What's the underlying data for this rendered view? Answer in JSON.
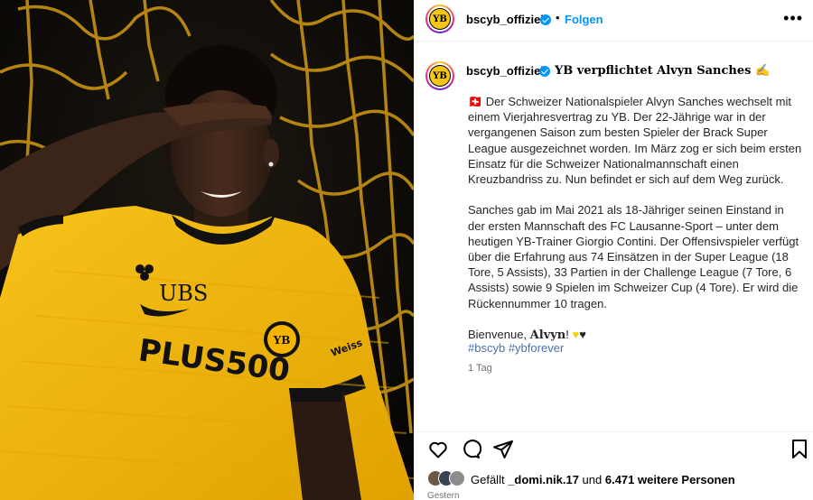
{
  "post": {
    "username": "bscyb_offiziell",
    "follow_label": "Folgen",
    "dot": "•",
    "more_label": "•••",
    "avatar_text": "YB"
  },
  "image": {
    "sponsor_top": "UBS",
    "sponsor_main": "PLUS500",
    "sleeve_text": "Weiss",
    "crest_text": "YB"
  },
  "caption": {
    "username": "bscyb_offiziell",
    "title": "YB verpflichtet Alvyn Sanches ✍️",
    "body_p1": "🇨🇭 Der Schweizer Nationalspieler Alvyn Sanches wechselt mit einem Vierjahresvertrag zu YB. Der 22-Jährige war in der vergangenen Saison zum besten Spieler der Brack Super League ausgezeichnet worden. Im März zog er sich beim ersten Einsatz für die Schweizer Nationalmannschaft einen Kreuzbandriss zu. Nun befindet er sich auf dem Weg zurück.",
    "body_p2": "Sanches gab im Mai 2021 als 18-Jähriger seinen Einstand in der ersten Mannschaft des FC Lausanne-Sport – unter dem heutigen YB-Trainer Giorgio Contini. Der Offensivspieler verfügt über die Erfahrung aus 74 Einsätzen in der Super League (18 Tore, 5 Assists), 33 Partien in der Challenge League (7 Tore, 6 Assists) sowie 9 Spielen im Schweizer Cup (4 Tore). Er wird die Rückennummer 10 tragen.",
    "body_p3_prefix": "Bienvenue, ",
    "body_p3_name": "Alvyn",
    "body_p3_suffix": "! ",
    "heart_yellow": "♥",
    "heart_black": "♥",
    "hashtag1": "#bscyb",
    "hashtag2": "#ybforever",
    "time": "1 Tag"
  },
  "footer": {
    "likes_prefix": "Gefällt ",
    "liker": "_domi.nik.17",
    "likes_mid": " und ",
    "likes_count": "6.471 weitere Personen",
    "time": "Gestern"
  },
  "colors": {
    "accent": "#0095f6",
    "jersey": "#f5b400",
    "net": "#d29a12"
  }
}
